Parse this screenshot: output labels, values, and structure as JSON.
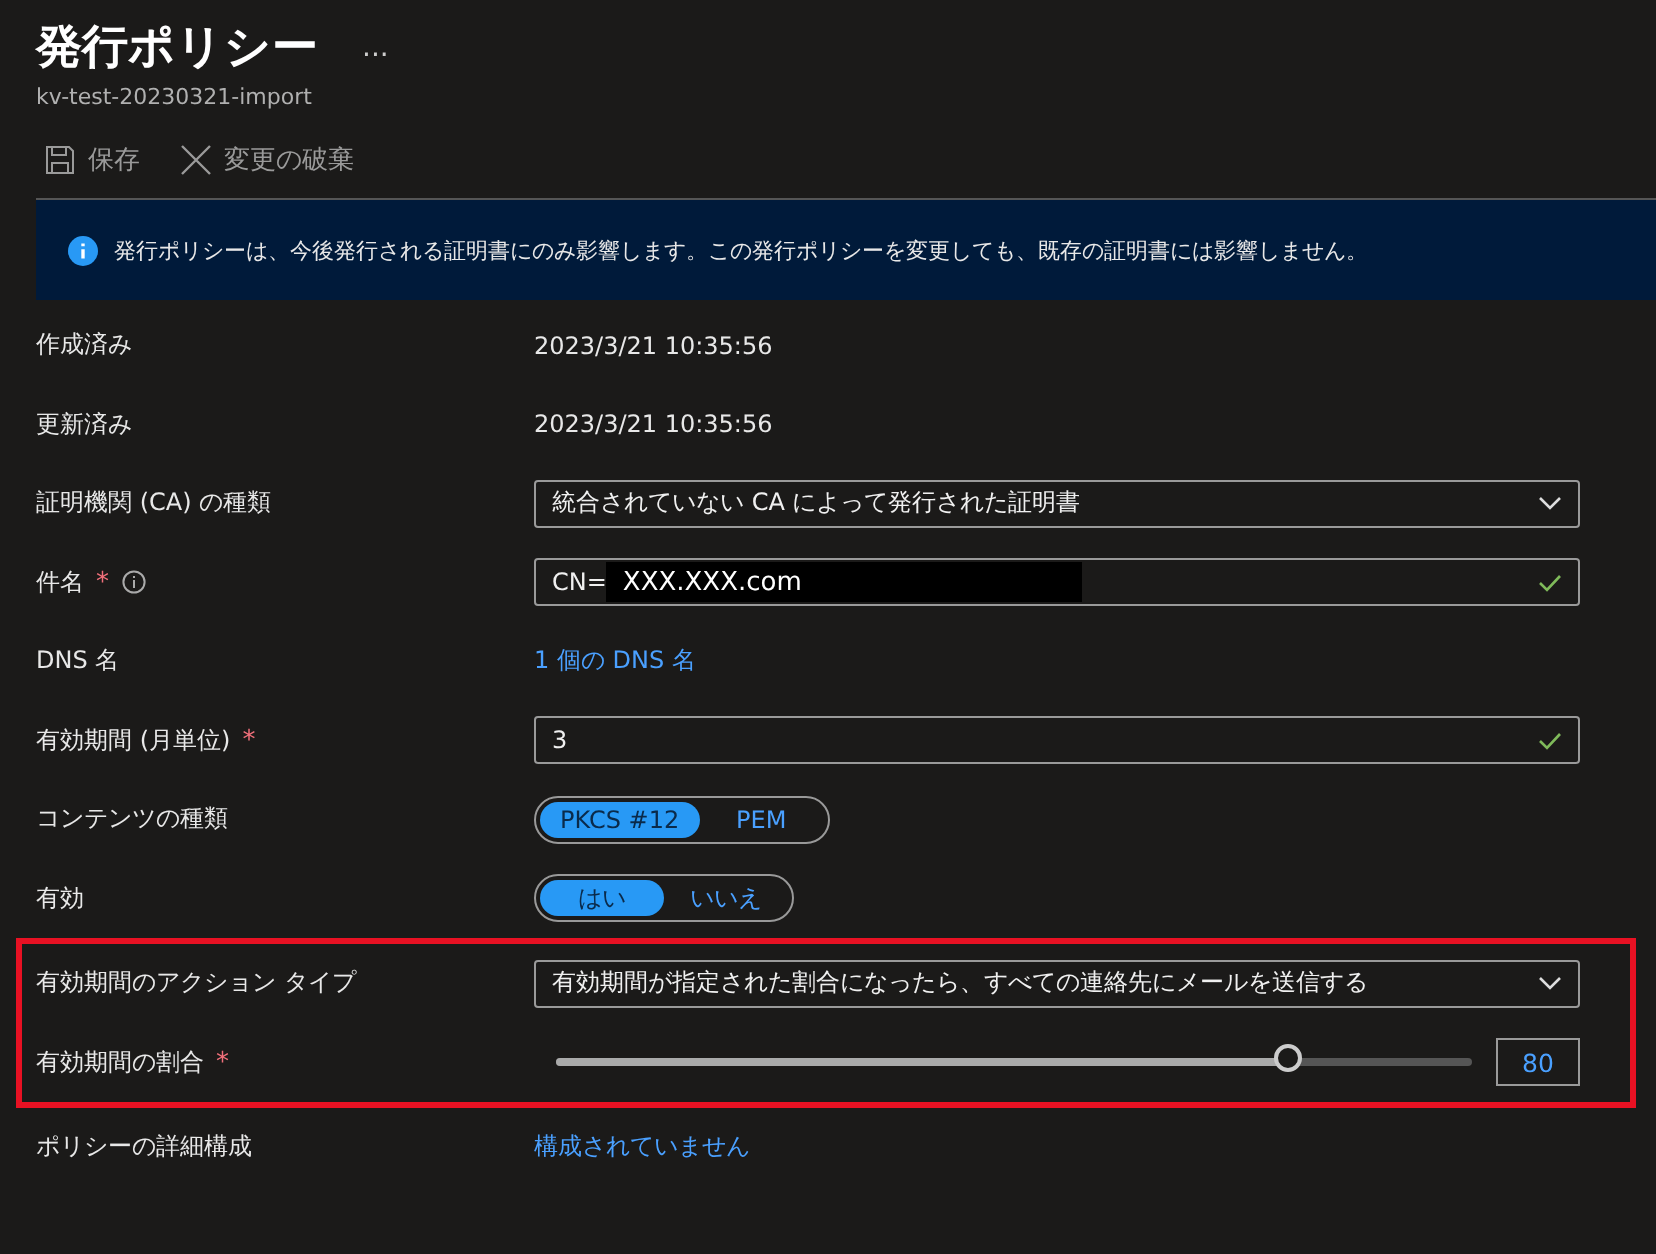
{
  "title": "発行ポリシー",
  "more": "...",
  "subtitle": "kv-test-20230321-import",
  "toolbar": [
    {
      "kind": "save",
      "label": "保存",
      "disabled": true
    },
    {
      "kind": "discard",
      "label": "変更の破棄",
      "disabled": true
    }
  ],
  "banner": {
    "text": "発行ポリシーは、今後発行される証明書にのみ影響します。この発行ポリシーを変更しても、既存の証明書には影響しません。"
  },
  "rows": [
    {
      "kind": "text",
      "label": "作成済み",
      "value": "2023/3/21 10:35:56"
    },
    {
      "kind": "text",
      "label": "更新済み",
      "value": "2023/3/21 10:35:56"
    },
    {
      "kind": "dropdown",
      "label": "証明機関 (CA) の種類",
      "value": "統合されていない CA によって発行された証明書"
    },
    {
      "kind": "input",
      "label": "件名",
      "mark": "*",
      "info": true,
      "prefix": "CN=",
      "value": "XXX.XXX.com",
      "redacted": true,
      "valid": true
    },
    {
      "kind": "link",
      "label": "DNS 名",
      "value": "1 個の DNS 名"
    },
    {
      "kind": "input",
      "label": "有効期間 (月単位)",
      "mark": "*",
      "value": "3",
      "valid": true
    },
    {
      "kind": "toggle",
      "label": "コンテンツの種類",
      "options": [
        {
          "label": "PKCS #12",
          "selected": true
        },
        {
          "label": "PEM",
          "selected": false
        }
      ]
    },
    {
      "kind": "toggle",
      "label": "有効",
      "options": [
        {
          "label": "はい",
          "selected": true
        },
        {
          "label": "いいえ",
          "selected": false
        }
      ]
    },
    {
      "kind": "dropdown",
      "label": "有効期間のアクション タイプ",
      "highlighted": true,
      "value": "有効期間が指定された割合になったら、すべての連絡先にメールを送信する"
    },
    {
      "kind": "slider",
      "label": "有効期間の割合",
      "mark": "*",
      "highlighted": true,
      "level": 0.8,
      "value": "80"
    },
    {
      "kind": "link",
      "label": "ポリシーの詳細構成",
      "value": "構成されていません"
    }
  ]
}
